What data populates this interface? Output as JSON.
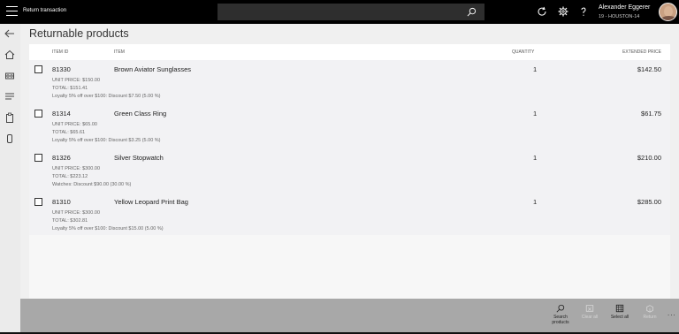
{
  "app": {
    "title": "Return transaction",
    "user": {
      "name": "Alexander Eggerer",
      "store": "19 - HOUSTON-14"
    }
  },
  "icons": {
    "menu": "hamburger-icon",
    "search": "search-icon",
    "refresh": "refresh-icon",
    "settings": "gear-icon",
    "help": "help-icon",
    "back": "back-arrow-icon",
    "home": "home-icon",
    "products": "products-icon",
    "list": "list-icon",
    "clipboard": "clipboard-icon",
    "device": "device-icon"
  },
  "page": {
    "heading": "Returnable products"
  },
  "table": {
    "columns": {
      "item_id": "ITEM ID",
      "item": "ITEM",
      "quantity": "QUANTITY",
      "extended_price": "EXTENDED PRICE"
    },
    "rows": [
      {
        "id": "81330",
        "name": "Brown Aviator Sunglasses",
        "qty": "1",
        "ext": "$142.50",
        "unit": "UNIT PRICE: $150.00",
        "total": "TOTAL: $151.41",
        "discount": "Loyalty 5% off over $100: Discount $7.50 (5.00 %)"
      },
      {
        "id": "81314",
        "name": "Green Class Ring",
        "qty": "1",
        "ext": "$61.75",
        "unit": "UNIT PRICE: $65.00",
        "total": "TOTAL: $65.61",
        "discount": "Loyalty 5% off over $100: Discount $3.25 (5.00 %)"
      },
      {
        "id": "81326",
        "name": "Silver Stopwatch",
        "qty": "1",
        "ext": "$210.00",
        "unit": "UNIT PRICE: $300.00",
        "total": "TOTAL: $223.12",
        "discount": "Watches: Discount $90.00 (30.00 %)"
      },
      {
        "id": "81310",
        "name": "Yellow Leopard Print Bag",
        "qty": "1",
        "ext": "$285.00",
        "unit": "UNIT PRICE: $300.00",
        "total": "TOTAL: $302.81",
        "discount": "Loyalty 5% off over $100: Discount $15.00 (5.00 %)"
      }
    ]
  },
  "actions": {
    "search_products": "Search products",
    "clear_all": "Clear all",
    "select_all": "Select all",
    "return": "Return",
    "more": "..."
  }
}
